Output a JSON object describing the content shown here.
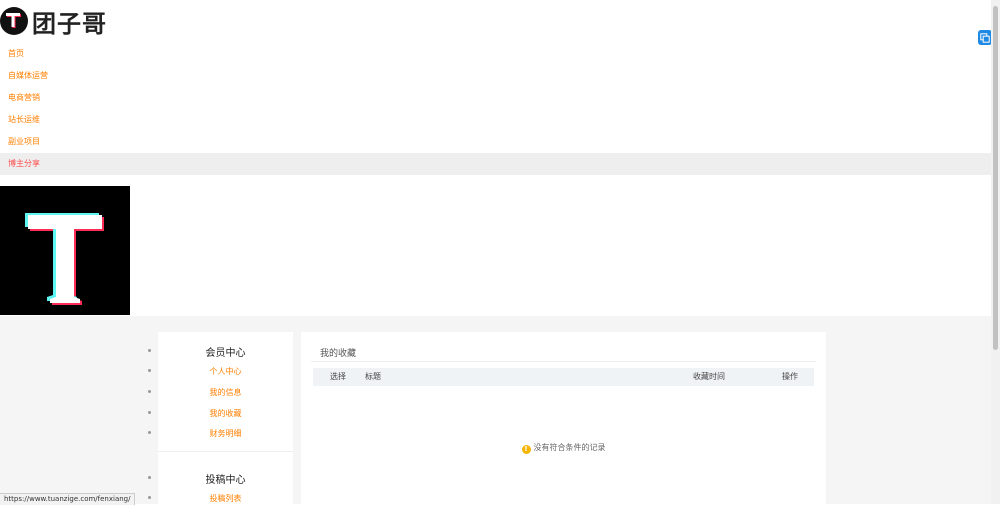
{
  "header": {
    "brand": "团子哥"
  },
  "nav": {
    "items": [
      {
        "label": "首页"
      },
      {
        "label": "自媒体运营"
      },
      {
        "label": "电商营销"
      },
      {
        "label": "站长运维"
      },
      {
        "label": "副业项目"
      },
      {
        "label": "博主分享"
      }
    ],
    "active_index": 5
  },
  "sidebar": {
    "member_title": "会员中心",
    "member_links": [
      {
        "label": "个人中心"
      },
      {
        "label": "我的信息"
      },
      {
        "label": "我的收藏"
      },
      {
        "label": "财务明细"
      }
    ],
    "submit_title": "投稿中心",
    "submit_links": [
      {
        "label": "投稿列表"
      }
    ]
  },
  "panel": {
    "title": "我的收藏",
    "columns": {
      "select": "选择",
      "title": "标题",
      "time": "收藏时间",
      "action": "操作"
    },
    "empty_text": "没有符合条件的记录"
  },
  "status_url": "https://www.tuanzige.com/fenxiang/",
  "icons": {
    "logo": "t-logo-icon",
    "banner": "t-banner-icon",
    "float": "translate-icon",
    "empty": "warning-icon"
  },
  "colors": {
    "accent": "#ff7f00",
    "active": "#ff4d4d",
    "float": "#1e88e5",
    "warn": "#f6b500"
  }
}
